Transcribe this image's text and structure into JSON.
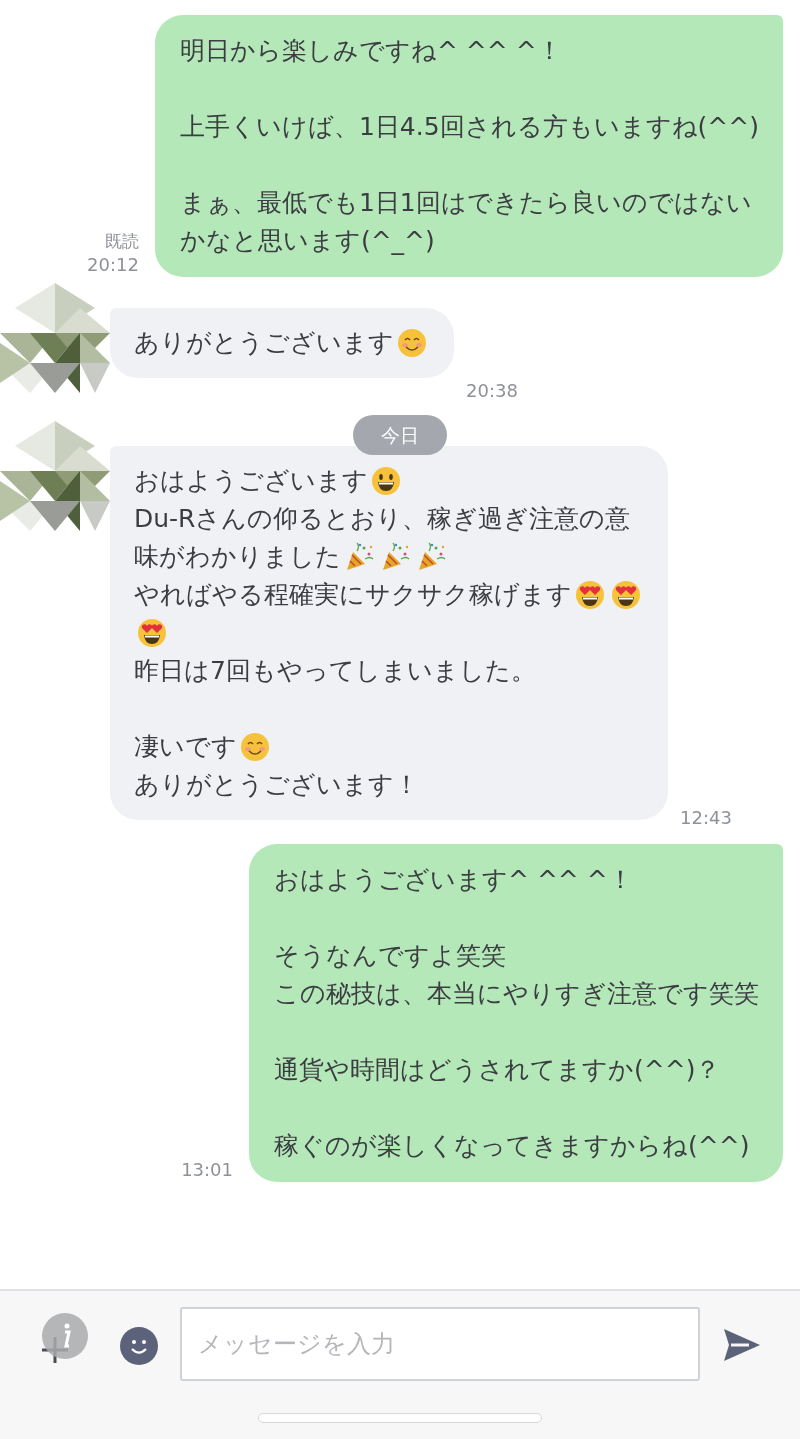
{
  "messages": [
    {
      "kind": "sent",
      "read_label": "既読",
      "time": "20:12",
      "paragraphs": [
        [
          [
            {
              "kind": "text",
              "text": "明日から楽しみですね^ ^^ ^！"
            }
          ]
        ],
        [
          [
            {
              "kind": "text",
              "text": "上手くいけば、1日4.5回される方もいますね(^^)"
            }
          ]
        ],
        [
          [
            {
              "kind": "text",
              "text": "まぁ、最低でも1日1回はできたら良いのではない"
            }
          ],
          [
            {
              "kind": "text",
              "text": "かなと思います(^_^)"
            }
          ]
        ]
      ]
    },
    {
      "kind": "received",
      "avatar": {
        "kind": "picture"
      },
      "time": "20:38",
      "paragraphs": [
        [
          [
            {
              "kind": "text",
              "text": "ありがとうございます"
            },
            {
              "kind": "smile"
            }
          ]
        ]
      ]
    },
    {
      "kind": "date",
      "label": "今日"
    },
    {
      "kind": "received",
      "avatar": {
        "kind": "picture"
      },
      "time": "12:43",
      "paragraphs": [
        [
          [
            {
              "kind": "text",
              "text": "おはようございます"
            },
            {
              "kind": "grin"
            }
          ],
          [
            {
              "kind": "text",
              "text": "Du-Rさんの仰るとおり、稼ぎ過ぎ注意の意"
            }
          ],
          [
            {
              "kind": "text",
              "text": "味がわかりました"
            },
            {
              "kind": "party"
            },
            {
              "kind": "party"
            },
            {
              "kind": "party"
            }
          ],
          [
            {
              "kind": "text",
              "text": "やればやる程確実にサクサク稼げます"
            },
            {
              "kind": "heart_eyes"
            },
            {
              "kind": "heart_eyes"
            }
          ],
          [
            {
              "kind": "heart_eyes"
            }
          ],
          [
            {
              "kind": "text",
              "text": "昨日は7回もやってしまいました。"
            }
          ]
        ],
        [
          [
            {
              "kind": "text",
              "text": "凄いです"
            },
            {
              "kind": "smile"
            }
          ],
          [
            {
              "kind": "text",
              "text": "ありがとうございます！"
            }
          ]
        ]
      ]
    },
    {
      "kind": "sent",
      "time": "13:01",
      "paragraphs": [
        [
          [
            {
              "kind": "text",
              "text": "おはようございます^ ^^ ^！"
            }
          ]
        ],
        [
          [
            {
              "kind": "text",
              "text": "そうなんですよ笑笑"
            }
          ],
          [
            {
              "kind": "text",
              "text": "この秘技は、本当にやりすぎ注意です笑笑"
            }
          ]
        ],
        [
          [
            {
              "kind": "text",
              "text": "通貨や時間はどうされてますか(^^)？"
            }
          ]
        ],
        [
          [
            {
              "kind": "text",
              "text": "稼ぐのが楽しくなってきますからね(^^)"
            }
          ]
        ]
      ]
    }
  ],
  "composer": {
    "placeholder": "メッセージを入力"
  }
}
